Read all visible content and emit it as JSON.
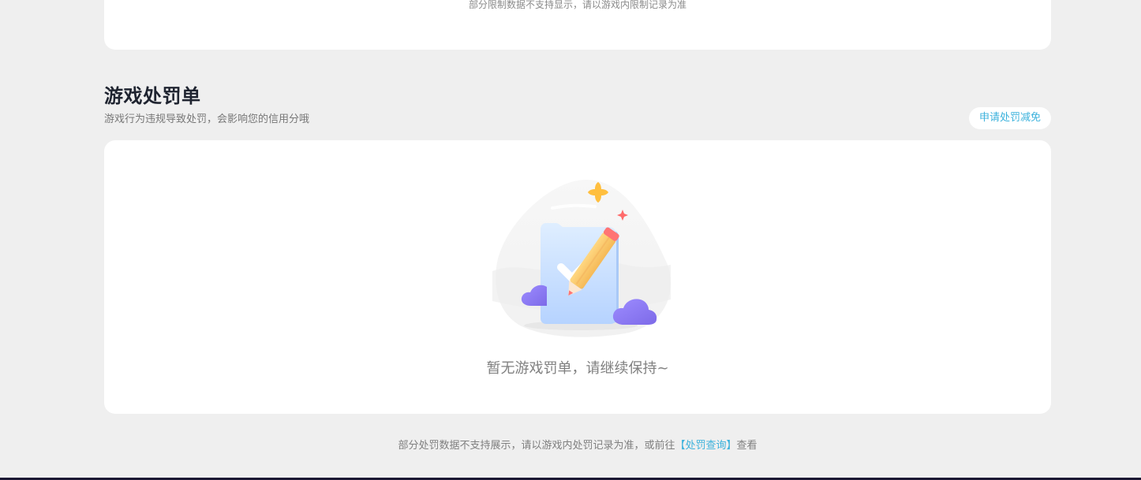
{
  "top_section": {
    "note": "部分限制数据不支持显示，请以游戏内限制记录为准"
  },
  "penalty_section": {
    "title": "游戏处罚单",
    "subtitle": "游戏行为违规导致处罚，会影响您的信用分哦",
    "apply_button_label": "申请处罚减免",
    "empty_message": "暂无游戏罚单，请继续保持~"
  },
  "footer": {
    "prefix": "部分处罚数据不支持展示，请以游戏内处罚记录为准，或前往",
    "link_text": "【处罚查询】",
    "suffix": "查看"
  },
  "theme": {
    "background": "#efefef",
    "card_background": "#ffffff",
    "accent": "#3cb2dc",
    "title_color": "#1f2430",
    "muted_text": "#808080",
    "bottom_strip": "#1b1833"
  },
  "icons": {
    "empty_state": "empty-checklist-illustration"
  }
}
